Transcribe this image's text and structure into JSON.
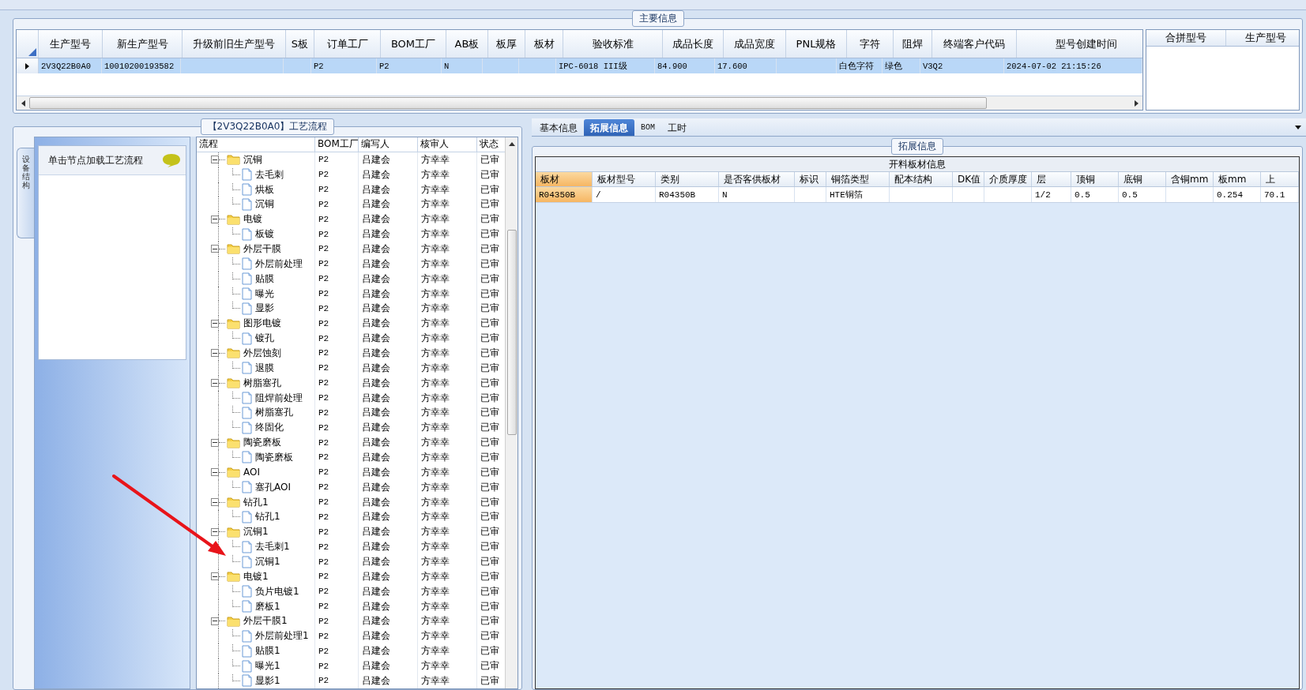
{
  "main_info": {
    "title": "主要信息",
    "columns": [
      "生产型号",
      "新生产型号",
      "升级前旧生产型号",
      "S板",
      "订单工厂",
      "BOM工厂",
      "AB板",
      "板厚",
      "板材",
      "验收标准",
      "成品长度",
      "成品宽度",
      "PNL规格",
      "字符",
      "阻焊",
      "终端客户代码",
      "型号创建时间"
    ],
    "rows": [
      {
        "selected": true,
        "cells": [
          "2V3Q22B0A0",
          "10010200193582",
          "",
          "",
          "P2",
          "P2",
          "N",
          "",
          "",
          "IPC-6018 III级",
          "84.900",
          "17.600",
          "",
          "白色字符",
          "绿色",
          "V3Q2",
          "2024-07-02 21:15:26"
        ]
      }
    ],
    "side_columns": [
      "合拼型号",
      "生产型号"
    ]
  },
  "process": {
    "title": "【2V3Q22B0A0】工艺流程",
    "side_tab": "设备结构",
    "hint": "单击节点加载工艺流程",
    "columns": [
      "流程",
      "BOM工厂",
      "编写人",
      "核审人",
      "状态"
    ],
    "tree": [
      {
        "name": "沉铜",
        "expanded": true,
        "cells": [
          "P2",
          "吕建会",
          "方幸幸",
          "已审"
        ],
        "children": [
          {
            "name": "去毛刺",
            "cells": [
              "P2",
              "吕建会",
              "方幸幸",
              "已审"
            ]
          },
          {
            "name": "烘板",
            "cells": [
              "P2",
              "吕建会",
              "方幸幸",
              "已审"
            ]
          },
          {
            "name": "沉铜",
            "cells": [
              "P2",
              "吕建会",
              "方幸幸",
              "已审"
            ]
          }
        ]
      },
      {
        "name": "电镀",
        "expanded": true,
        "cells": [
          "P2",
          "吕建会",
          "方幸幸",
          "已审"
        ],
        "children": [
          {
            "name": "板镀",
            "cells": [
              "P2",
              "吕建会",
              "方幸幸",
              "已审"
            ]
          }
        ]
      },
      {
        "name": "外层干膜",
        "expanded": true,
        "cells": [
          "P2",
          "吕建会",
          "方幸幸",
          "已审"
        ],
        "children": [
          {
            "name": "外层前处理",
            "cells": [
              "P2",
              "吕建会",
              "方幸幸",
              "已审"
            ]
          },
          {
            "name": "贴膜",
            "cells": [
              "P2",
              "吕建会",
              "方幸幸",
              "已审"
            ]
          },
          {
            "name": "曝光",
            "cells": [
              "P2",
              "吕建会",
              "方幸幸",
              "已审"
            ]
          },
          {
            "name": "显影",
            "cells": [
              "P2",
              "吕建会",
              "方幸幸",
              "已审"
            ]
          }
        ]
      },
      {
        "name": "图形电镀",
        "expanded": true,
        "cells": [
          "P2",
          "吕建会",
          "方幸幸",
          "已审"
        ],
        "children": [
          {
            "name": "镀孔",
            "cells": [
              "P2",
              "吕建会",
              "方幸幸",
              "已审"
            ]
          }
        ]
      },
      {
        "name": "外层蚀刻",
        "expanded": true,
        "cells": [
          "P2",
          "吕建会",
          "方幸幸",
          "已审"
        ],
        "children": [
          {
            "name": "退膜",
            "cells": [
              "P2",
              "吕建会",
              "方幸幸",
              "已审"
            ]
          }
        ]
      },
      {
        "name": "树脂塞孔",
        "expanded": true,
        "cells": [
          "P2",
          "吕建会",
          "方幸幸",
          "已审"
        ],
        "children": [
          {
            "name": "阻焊前处理",
            "cells": [
              "P2",
              "吕建会",
              "方幸幸",
              "已审"
            ]
          },
          {
            "name": "树脂塞孔",
            "cells": [
              "P2",
              "吕建会",
              "方幸幸",
              "已审"
            ]
          },
          {
            "name": "终固化",
            "cells": [
              "P2",
              "吕建会",
              "方幸幸",
              "已审"
            ]
          }
        ]
      },
      {
        "name": "陶瓷磨板",
        "expanded": true,
        "cells": [
          "P2",
          "吕建会",
          "方幸幸",
          "已审"
        ],
        "children": [
          {
            "name": "陶瓷磨板",
            "cells": [
              "P2",
              "吕建会",
              "方幸幸",
              "已审"
            ]
          }
        ]
      },
      {
        "name": "AOI",
        "expanded": true,
        "cells": [
          "P2",
          "吕建会",
          "方幸幸",
          "已审"
        ],
        "children": [
          {
            "name": "塞孔AOI",
            "cells": [
              "P2",
              "吕建会",
              "方幸幸",
              "已审"
            ]
          }
        ]
      },
      {
        "name": "钻孔1",
        "expanded": true,
        "cells": [
          "P2",
          "吕建会",
          "方幸幸",
          "已审"
        ],
        "children": [
          {
            "name": "钻孔1",
            "cells": [
              "P2",
              "吕建会",
              "方幸幸",
              "已审"
            ]
          }
        ]
      },
      {
        "name": "沉铜1",
        "expanded": true,
        "cells": [
          "P2",
          "吕建会",
          "方幸幸",
          "已审"
        ],
        "children": [
          {
            "name": "去毛刺1",
            "cells": [
              "P2",
              "吕建会",
              "方幸幸",
              "已审"
            ]
          },
          {
            "name": "沉铜1",
            "cells": [
              "P2",
              "吕建会",
              "方幸幸",
              "已审"
            ]
          }
        ]
      },
      {
        "name": "电镀1",
        "expanded": true,
        "cells": [
          "P2",
          "吕建会",
          "方幸幸",
          "已审"
        ],
        "children": [
          {
            "name": "负片电镀1",
            "cells": [
              "P2",
              "吕建会",
              "方幸幸",
              "已审"
            ]
          },
          {
            "name": "磨板1",
            "cells": [
              "P2",
              "吕建会",
              "方幸幸",
              "已审"
            ]
          }
        ]
      },
      {
        "name": "外层干膜1",
        "expanded": true,
        "cells": [
          "P2",
          "吕建会",
          "方幸幸",
          "已审"
        ],
        "children": [
          {
            "name": "外层前处理1",
            "cells": [
              "P2",
              "吕建会",
              "方幸幸",
              "已审"
            ]
          },
          {
            "name": "贴膜1",
            "cells": [
              "P2",
              "吕建会",
              "方幸幸",
              "已审"
            ]
          },
          {
            "name": "曝光1",
            "cells": [
              "P2",
              "吕建会",
              "方幸幸",
              "已审"
            ]
          },
          {
            "name": "显影1",
            "cells": [
              "P2",
              "吕建会",
              "方幸幸",
              "已审"
            ]
          }
        ]
      }
    ]
  },
  "detail": {
    "tabs": [
      {
        "label": "基本信息",
        "selected": false
      },
      {
        "label": "拓展信息",
        "selected": true
      },
      {
        "label": "BOM",
        "selected": false
      },
      {
        "label": "工时",
        "selected": false
      }
    ],
    "group_title": "拓展信息",
    "grid_title": "开料板材信息",
    "columns": [
      {
        "label": "板材",
        "selected": true
      },
      {
        "label": "板材型号",
        "selected": false
      },
      {
        "label": "类别",
        "selected": false
      },
      {
        "label": "是否客供板材",
        "selected": false
      },
      {
        "label": "标识",
        "selected": false
      },
      {
        "label": "铜箔类型",
        "selected": false
      },
      {
        "label": "配本结构",
        "selected": false
      },
      {
        "label": "DK值",
        "selected": false
      },
      {
        "label": "介质厚度",
        "selected": false
      },
      {
        "label": "层",
        "selected": false
      },
      {
        "label": "顶铜",
        "selected": false
      },
      {
        "label": "底铜",
        "selected": false
      },
      {
        "label": "含铜mm",
        "selected": false
      },
      {
        "label": "板mm",
        "selected": false
      },
      {
        "label": "上",
        "selected": false
      }
    ],
    "rows": [
      {
        "cells": [
          "R04350B",
          "/",
          "R04350B",
          "N",
          "",
          "HTE铜箔",
          "",
          "",
          "",
          "1/2",
          "0.5",
          "0.5",
          "",
          "0.254",
          "70.1"
        ]
      }
    ]
  }
}
